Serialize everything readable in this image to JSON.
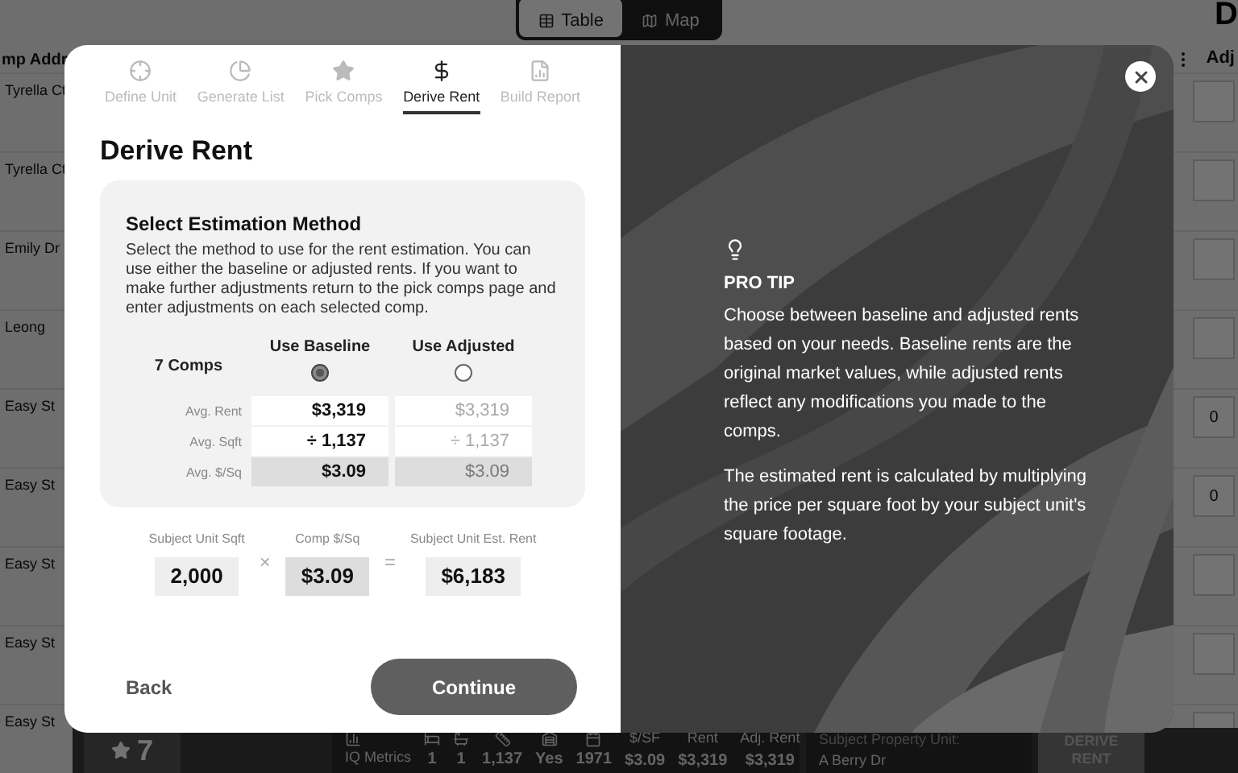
{
  "background": {
    "view_toggle": [
      {
        "label": "Table",
        "selected": true
      },
      {
        "label": "Map",
        "selected": false
      }
    ],
    "corner_text": "D",
    "table": {
      "columns": [
        "mp Addr",
        "Adj"
      ],
      "rows": [
        {
          "address": "Tyrella Ct"
        },
        {
          "address": "Tyrella Ct"
        },
        {
          "address": "Emily Dr"
        },
        {
          "address": "Leong"
        },
        {
          "address": "Easy St",
          "adj": "0"
        },
        {
          "address": "Easy St",
          "adj": "0"
        },
        {
          "address": "Easy St"
        },
        {
          "address": "Easy St"
        },
        {
          "address": "Easy St"
        }
      ]
    },
    "bottom_bar": {
      "comps_count": "7",
      "metrics_title": "IQ Metrics",
      "metrics": [
        {
          "kind": "bed",
          "value": "1"
        },
        {
          "kind": "bath",
          "value": "1"
        },
        {
          "kind": "area",
          "value": "1,137"
        },
        {
          "kind": "garage",
          "value": "Yes"
        },
        {
          "kind": "year",
          "value": "1971"
        },
        {
          "kind": "text",
          "header": "$/SF",
          "value": "$3.09"
        },
        {
          "kind": "text",
          "header": "Rent",
          "value": "$3,319"
        },
        {
          "kind": "text",
          "header": "Adj. Rent",
          "value": "$3,319"
        }
      ],
      "subject_label": "Subject Property Unit:",
      "subject_value": "A Berry Dr",
      "action": "DERIVE RENT"
    }
  },
  "modal": {
    "steps": [
      {
        "kind": "target",
        "label": "Define Unit",
        "selected": false
      },
      {
        "kind": "pie",
        "label": "Generate List",
        "selected": false
      },
      {
        "kind": "star",
        "label": "Pick Comps",
        "selected": false
      },
      {
        "kind": "dollar",
        "label": "Derive Rent",
        "selected": true
      },
      {
        "kind": "report",
        "label": "Build Report",
        "selected": false
      }
    ],
    "title": "Derive Rent",
    "card": {
      "heading": "Select Estimation Method",
      "description": "Select the method to use for the rent estimation. You can use either the baseline or adjusted rents. If you want to make further adjustments return to the pick comps page and enter adjustments on each selected comp.",
      "count_label": "7 Comps",
      "rows": [
        {
          "label": "Avg. Rent",
          "kind": "input"
        },
        {
          "label": "Avg. Sqft",
          "kind": "input"
        },
        {
          "label": "Avg. $/Sq",
          "kind": "result"
        }
      ],
      "options": [
        {
          "label": "Use Baseline",
          "selected": true,
          "cells": [
            "$3,319",
            "÷ 1,137",
            "$3.09"
          ]
        },
        {
          "label": "Use Adjusted",
          "selected": false,
          "cells": [
            "$3,319",
            "÷ 1,137",
            "$3.09"
          ]
        }
      ]
    },
    "calculation": [
      {
        "kind": "value",
        "label": "Subject Unit Sqft",
        "value": "2,000"
      },
      {
        "kind": "operator",
        "symbol": "×"
      },
      {
        "kind": "value",
        "label": "Comp $/Sq",
        "value": "$3.09",
        "shaded": true
      },
      {
        "kind": "operator",
        "symbol": "="
      },
      {
        "kind": "value",
        "label": "Subject Unit Est. Rent",
        "value": "$6,183",
        "shaded": false
      }
    ],
    "back_button": "Back",
    "continue_button": "Continue",
    "tip": {
      "title": "PRO TIP",
      "paragraphs": [
        "Choose between baseline and adjusted rents based on your needs. Baseline rents are the original market values, while adjusted rents reflect any modifications you made to the comps.",
        "The estimated rent is calculated by multiplying the price per square foot by your subject unit's square footage."
      ]
    }
  }
}
